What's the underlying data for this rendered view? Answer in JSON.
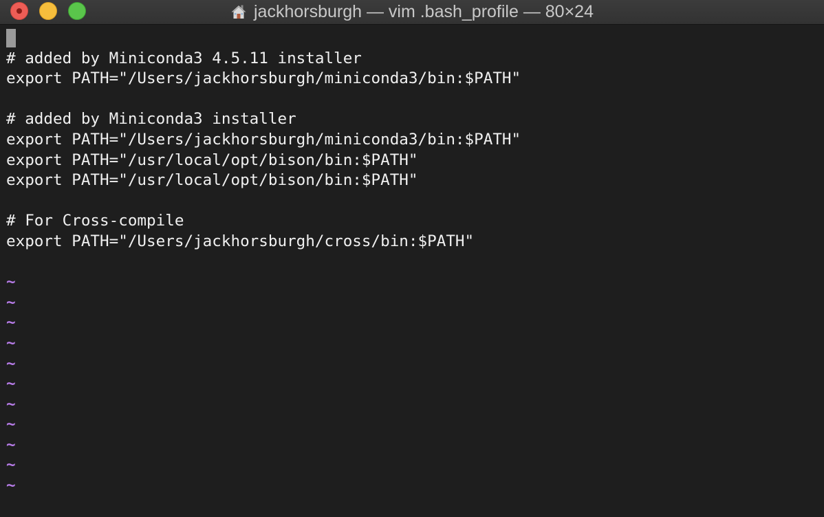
{
  "window": {
    "title": "jackhorsburgh — vim .bash_profile — 80×24",
    "title_icon": "home-icon",
    "traffic_lights": {
      "close": "#ee5d56",
      "minimize": "#f6be3c",
      "zoom": "#5ac54b"
    }
  },
  "editor": {
    "background": "#1e1e1e",
    "text_color": "#f0f0f0",
    "tilde_color": "#b77ce8",
    "lines": [
      "",
      "# added by Miniconda3 4.5.11 installer",
      "export PATH=\"/Users/jackhorsburgh/miniconda3/bin:$PATH\"",
      "",
      "# added by Miniconda3 installer",
      "export PATH=\"/Users/jackhorsburgh/miniconda3/bin:$PATH\"",
      "export PATH=\"/usr/local/opt/bison/bin:$PATH\"",
      "export PATH=\"/usr/local/opt/bison/bin:$PATH\"",
      "",
      "# For Cross-compile",
      "export PATH=\"/Users/jackhorsburgh/cross/bin:$PATH\"",
      ""
    ],
    "empty_line_markers": [
      "~",
      "~",
      "~",
      "~",
      "~",
      "~",
      "~",
      "~",
      "~",
      "~",
      "~"
    ]
  }
}
